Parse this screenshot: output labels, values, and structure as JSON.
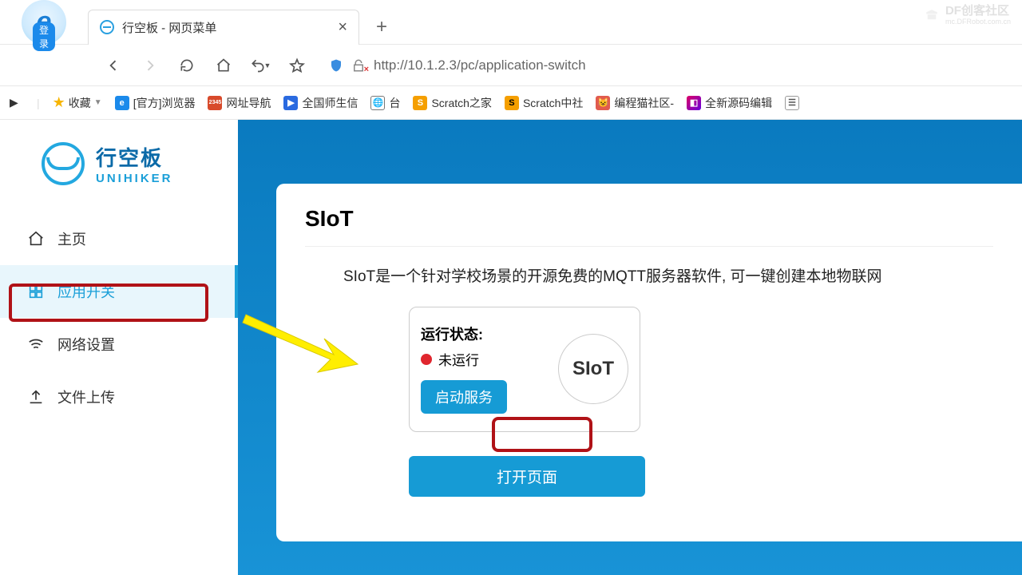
{
  "watermark": {
    "title": "DF创客社区",
    "sub": "mc.DFRobot.com.cn"
  },
  "browser": {
    "login_cap": "登录",
    "tab_title": "行空板 - 网页菜单",
    "url": "http://10.1.2.3/pc/application-switch"
  },
  "bookmarks": {
    "fav": "收藏",
    "items": [
      {
        "label": "[官方]浏览器",
        "color": "#1b8aeb",
        "glyph": "e"
      },
      {
        "label": "网址导航",
        "color": "#d84a2b",
        "glyph": "2345"
      },
      {
        "label": "全国师生信",
        "color": "#2a6ae0",
        "glyph": "▶"
      },
      {
        "label": "台",
        "color": "#555",
        "glyph": "🌐"
      },
      {
        "label": "Scratch之家",
        "color": "#f59f00",
        "glyph": "S"
      },
      {
        "label": "Scratch中社",
        "color": "#f59f00",
        "glyph": "S"
      },
      {
        "label": "编程猫社区-",
        "color": "#e15b4e",
        "glyph": "🐱"
      },
      {
        "label": "全新源码编辑",
        "color": "#c060d8",
        "glyph": "◧"
      }
    ]
  },
  "brand": {
    "cn": "行空板",
    "en": "UNIHIKER"
  },
  "sidebar": {
    "items": [
      {
        "label": "主页",
        "icon": "home"
      },
      {
        "label": "应用开关",
        "icon": "apps",
        "active": true
      },
      {
        "label": "网络设置",
        "icon": "wifi"
      },
      {
        "label": "文件上传",
        "icon": "upload"
      }
    ]
  },
  "content": {
    "title": "SIoT",
    "description": "SIoT是一个针对学校场景的开源免费的MQTT服务器软件, 可一键创建本地物联网",
    "status_label": "运行状态:",
    "status_text": "未运行",
    "start_btn": "启动服务",
    "siot_logo": "SIoT",
    "open_page_btn": "打开页面"
  }
}
